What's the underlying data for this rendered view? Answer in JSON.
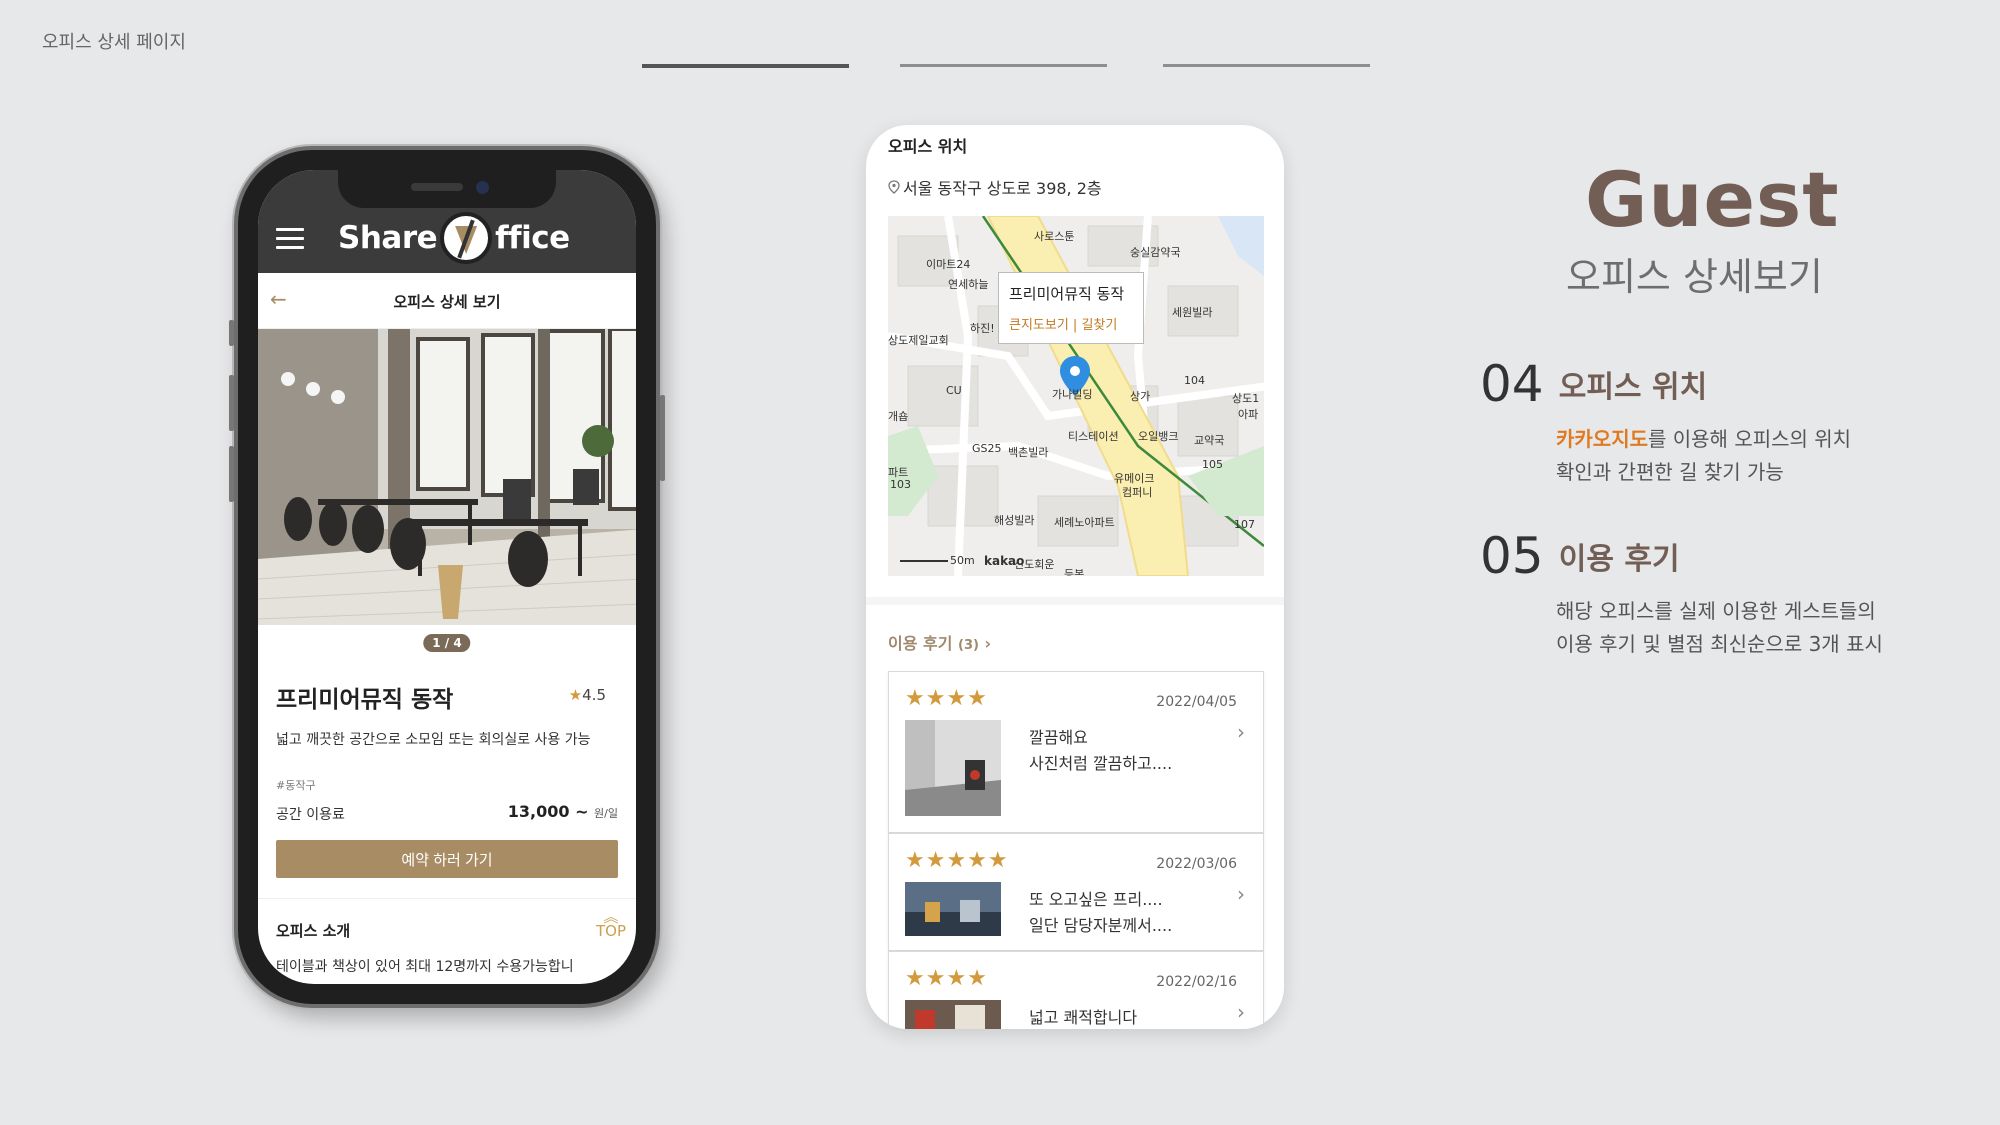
{
  "page": {
    "label": "오피스 상세 페이지"
  },
  "phone1": {
    "logo_left": "Share",
    "logo_right": "ffice",
    "sub_title": "오피스 상세 보기",
    "pager": "1 / 4",
    "office_name": "프리미어뮤직 동작",
    "rating": "4.5",
    "description": "넓고 깨끗한 공간으로 소모임 또는 회의실로 사용 가능",
    "hashtag": "#동작구",
    "fee_label": "공간 이용료",
    "fee_value": "13,000 ~",
    "fee_unit": "원/일",
    "book_button": "예약 하러 가기",
    "intro_title": "오피스 소개",
    "top_label": "TOP",
    "intro_text": "테이블과 책상이 있어 최대 12명까지 수용가능합니"
  },
  "phone2": {
    "location_title": "오피스 위치",
    "address": "서울 동작구 상도로 398, 2층",
    "map": {
      "tip_name": "프리미어뮤직 동작",
      "tip_links": "큰지도보기 | 길찾기",
      "labels": [
        "사로스툰",
        "숭실감약국",
        "이마트24",
        "연세하늘",
        "세원빌라",
        "하진!",
        "상도제일교회",
        "CU",
        "가나빌딩",
        "상가",
        "104",
        "상도1",
        "아파",
        "개숍",
        "GS25",
        "백촌빌라",
        "티스테이션",
        "오일뱅크",
        "교약국",
        "105",
        "파트",
        "103",
        "유메이크",
        "컴퍼니",
        "해성빌라",
        "세례노아파트",
        "107",
        "50m",
        "kakao",
        "신도회운",
        "등복"
      ]
    },
    "reviews_title": "이용 후기",
    "reviews_count": "(3)",
    "reviews": [
      {
        "stars": "★★★★",
        "date": "2022/04/05",
        "line1": "깔끔해요",
        "line2": "사진처럼 깔끔하고...."
      },
      {
        "stars": "★★★★★",
        "date": "2022/03/06",
        "line1": "또 오고싶은 프리....",
        "line2": "일단 담당자분께서...."
      },
      {
        "stars": "★★★★",
        "date": "2022/02/16",
        "line1": "넓고 쾌적합니다",
        "line2": ""
      }
    ]
  },
  "right": {
    "title": "Guest",
    "subtitle": "오피스 상세보기",
    "features": [
      {
        "num": "04",
        "name": "오피스 위치",
        "highlight": "카카오지도",
        "desc_rest": "를 이용해 오피스의 위치",
        "desc_line2": "확인과 간편한 길 찾기 가능"
      },
      {
        "num": "05",
        "name": "이용 후기",
        "desc_line1": "해당 오피스를 실제 이용한 게스트들의",
        "desc_line2": "이용 후기 및 별점 최신순으로 3개 표시"
      }
    ]
  },
  "colors": {
    "accent": "#a88d64",
    "title_brown": "#735e56",
    "highlight_orange": "#e07a20",
    "star": "#d39a3d"
  }
}
